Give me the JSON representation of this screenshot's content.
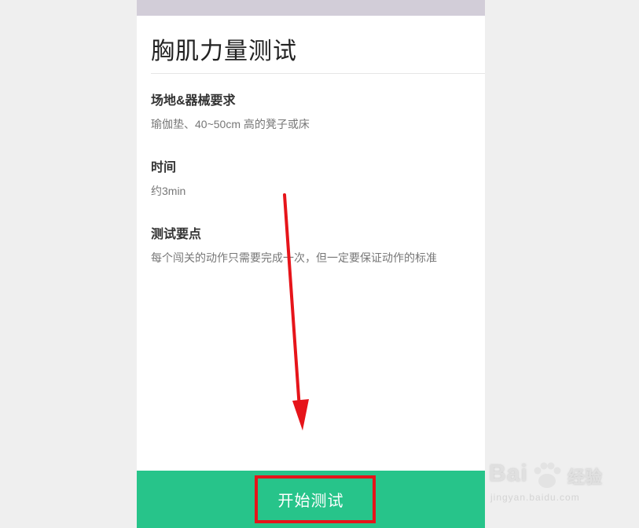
{
  "page": {
    "title": "胸肌力量测试"
  },
  "sections": [
    {
      "heading": "场地&器械要求",
      "body": "瑜伽垫、40~50cm 高的凳子或床"
    },
    {
      "heading": "时间",
      "body": "约3min"
    },
    {
      "heading": "测试要点",
      "body": "每个闯关的动作只需要完成一次，但一定要保证动作的标准"
    }
  ],
  "start_button": {
    "label": "开始测试"
  },
  "annotation": {
    "arrow_color": "#e6141a",
    "box_color": "#e6141a"
  },
  "watermark": {
    "brand": "Bai",
    "brand_suffix": "经验",
    "url": "jingyan.baidu.com"
  },
  "colors": {
    "accent": "#27c48a"
  }
}
